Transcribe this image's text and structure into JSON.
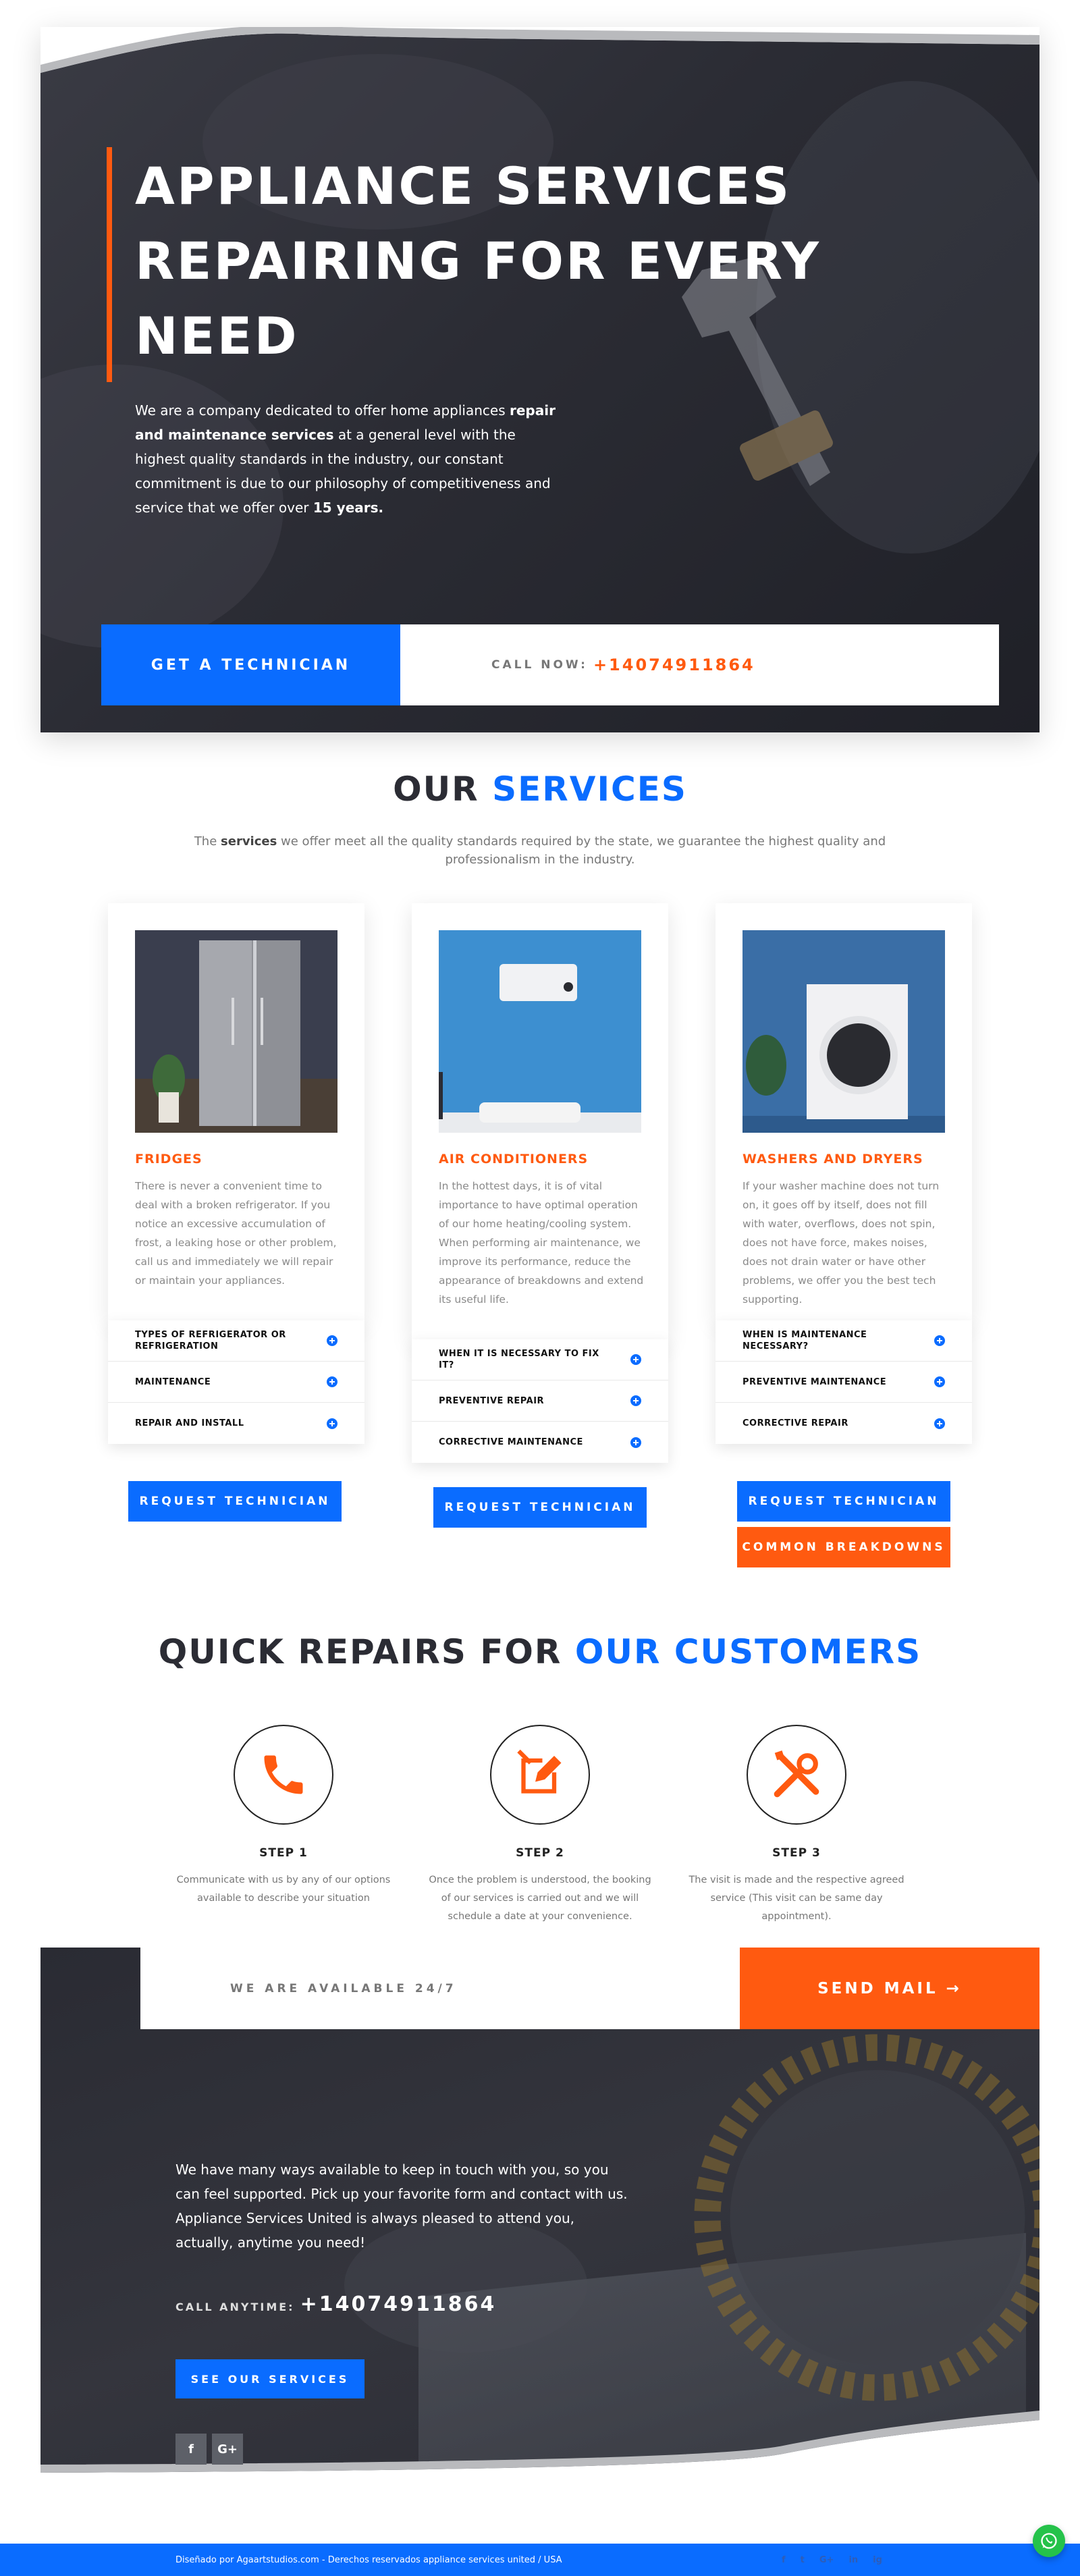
{
  "hero": {
    "title_line1": "APPLIANCE SERVICES",
    "title_line2": "REPAIRING FOR EVERY",
    "title_line3": "NEED",
    "text_1": "We are a company dedicated to offer home appliances ",
    "text_bold_1": "repair and maintenance services",
    "text_2": " at a general level with the highest quality standards in the industry, our constant commitment is due to our philosophy of competitiveness and service that we offer over ",
    "text_bold_2": "15 years.",
    "cta_label": "GET A TECHNICIAN",
    "call_label": "CALL NOW:",
    "phone": "+14074911864"
  },
  "services": {
    "title_a": "OUR ",
    "title_b": "SERVICES",
    "sub_a": "The ",
    "sub_bold": "services",
    "sub_b": " we offer meet all the quality standards required by the state, we guarantee the highest quality and professionalism in the industry.",
    "cards": [
      {
        "title": "FRIDGES",
        "desc": "There is never a convenient time to deal with a broken refrigerator. If you notice an excessive accumulation of frost, a leaking hose or other problem, call us and immediately we will repair or maintain your appliances.",
        "items": [
          "TYPES OF REFRIGERATOR OR REFRIGERATION",
          "MAINTENANCE",
          "REPAIR AND INSTALL"
        ],
        "button": "REQUEST TECHNICIAN"
      },
      {
        "title": "AIR CONDITIONERS",
        "desc": "In the hottest days, it is of vital importance to have optimal operation of our home heating/cooling system. When performing air maintenance, we improve its performance, reduce the appearance of breakdowns and extend its useful life.",
        "items": [
          "WHEN IT IS NECESSARY TO FIX IT?",
          "PREVENTIVE REPAIR",
          "CORRECTIVE MAINTENANCE"
        ],
        "button": "REQUEST TECHNICIAN"
      },
      {
        "title": "WASHERS AND DRYERS",
        "desc": "If your washer machine does not turn on, it goes off by itself, does not fill with water, overflows, does not spin, does not have force, makes noises, does not drain water or have other problems, we offer you the best tech supporting.",
        "items": [
          "WHEN IS MAINTENANCE NECESSARY?",
          "PREVENTIVE MAINTENANCE",
          "CORRECTIVE REPAIR"
        ],
        "button": "REQUEST TECHNICIAN",
        "button2": "COMMON BREAKDOWNS"
      }
    ]
  },
  "repairs": {
    "title_a": "QUICK REPAIRS FOR ",
    "title_b": "OUR CUSTOMERS",
    "steps": [
      {
        "title": "STEP 1",
        "text": "Communicate with us by any of our options available to describe your situation",
        "icon": "phone-icon"
      },
      {
        "title": "STEP 2",
        "text": "Once the problem is understood, the booking of our services is carried out and we will schedule a date at your convenience.",
        "icon": "edit-icon"
      },
      {
        "title": "STEP 3",
        "text": "The visit is made and the respective agreed service (This visit can be same day appointment).",
        "icon": "tools-icon"
      }
    ],
    "accent_color": "#ff5a10"
  },
  "contact": {
    "available": "WE ARE AVAILABLE 24/7",
    "send_mail": "SEND MAIL →",
    "text": "We have many ways available to keep in touch with you, so you can feel supported. Pick up your favorite form and contact with us. Appliance Services United is always pleased to attend you, actually, anytime you need!",
    "call_label": "CALL ANYTIME:",
    "phone": "+14074911864",
    "button": "SEE OUR SERVICES",
    "social": [
      "f",
      "G+"
    ]
  },
  "footer": {
    "copyright": "Diseñado por Agaartstudios.com - Derechos reservados appliance services united / USA",
    "icons": [
      "f",
      "t",
      "G+",
      "in",
      "ig"
    ]
  },
  "colors": {
    "primary": "#0a6cff",
    "accent": "#ff5a10",
    "dark": "#2b2c34"
  }
}
